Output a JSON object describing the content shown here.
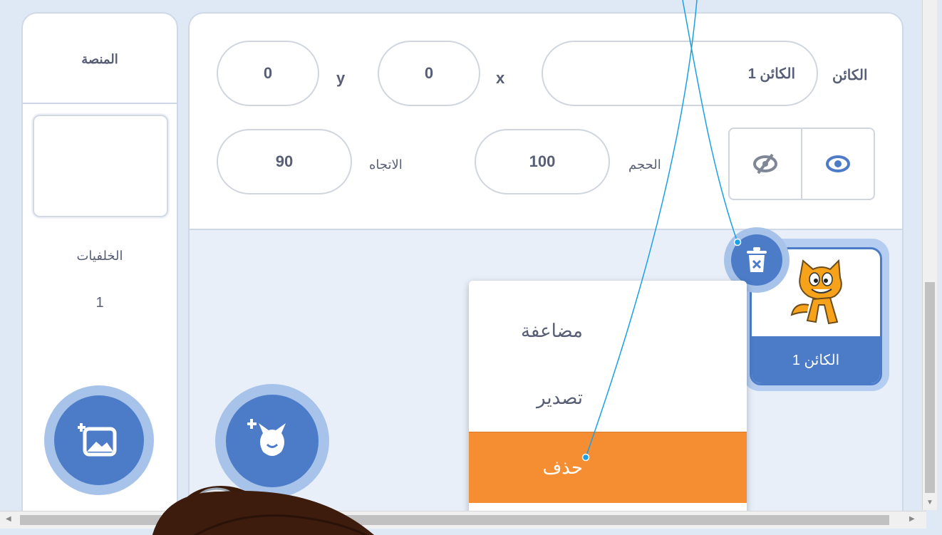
{
  "stage": {
    "title": "المنصة",
    "backdrops_label": "الخلفيات",
    "backdrops_count": "1"
  },
  "sprite_info": {
    "sprite_label": "الكائن",
    "sprite_name": "الكائن 1",
    "x_label": "x",
    "x_value": "0",
    "y_label": "y",
    "y_value": "0",
    "size_label": "الحجم",
    "size_value": "100",
    "direction_label": "الاتجاه",
    "direction_value": "90"
  },
  "sprite_card": {
    "name": "الكائن 1"
  },
  "context_menu": {
    "items": [
      {
        "label": "مضاعفة"
      },
      {
        "label": "تصدير"
      },
      {
        "label": "حذف"
      }
    ]
  },
  "colors": {
    "accent": "#4c7cc8",
    "menu_highlight": "#f58e33",
    "callout_line": "#1aa0e6"
  },
  "icons": [
    "show-eye-icon",
    "hide-eye-icon",
    "trash-delete-icon",
    "choose-sprite-icon",
    "choose-backdrop-icon",
    "cat-sprite-costume"
  ]
}
